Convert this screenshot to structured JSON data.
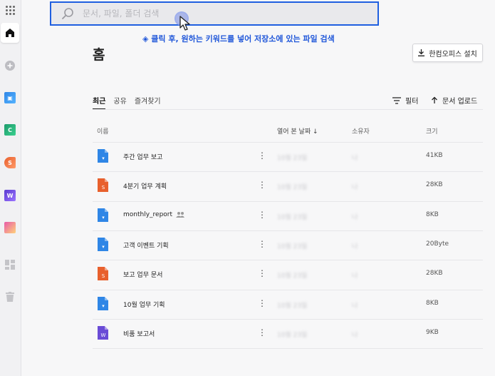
{
  "search": {
    "placeholder": "문서, 파일, 폴더 검색"
  },
  "hint": "◈ 클릭 후, 원하는 키워드를 넣어 저장소에 있는 파일 검색",
  "page_title": "홈",
  "install_button": "한컴오피스 설치",
  "tabs": [
    "최근",
    "공유",
    "즐겨찾기"
  ],
  "actions": {
    "filter": "필터",
    "upload": "문서 업로드"
  },
  "columns": {
    "name": "이름",
    "opened": "열어 본 날짜 ↓",
    "owner": "소유자",
    "size": "크기"
  },
  "rail_icons": [
    "apps-grid-icon",
    "home-icon",
    "add-icon",
    "docs-app-icon",
    "sheet-app-icon",
    "slide-app-icon",
    "word-app-icon",
    "note-app-icon",
    "template-icon",
    "trash-icon"
  ],
  "files": [
    {
      "name": "주간 업무 보고",
      "type": "docs",
      "opened": "10월 23일",
      "owner": "나",
      "size": "41KB",
      "shared": false
    },
    {
      "name": "4분기 업무 계획",
      "type": "slide",
      "opened": "10월 23일",
      "owner": "나",
      "size": "28KB",
      "shared": false
    },
    {
      "name": "monthly_report",
      "type": "docs",
      "opened": "10월 23일",
      "owner": "나",
      "size": "8KB",
      "shared": true
    },
    {
      "name": "고객 이벤트 기획",
      "type": "docs",
      "opened": "10월 23일",
      "owner": "나",
      "size": "20Byte",
      "shared": false
    },
    {
      "name": "보고 업무 문서",
      "type": "slide",
      "opened": "10월 23일",
      "owner": "나",
      "size": "28KB",
      "shared": false
    },
    {
      "name": "10월 업무 기획",
      "type": "docs",
      "opened": "10월 23일",
      "owner": "나",
      "size": "8KB",
      "shared": false
    },
    {
      "name": "비품 보고서",
      "type": "word",
      "opened": "10월 23일",
      "owner": "나",
      "size": "9KB",
      "shared": false
    }
  ],
  "colors": {
    "accent": "#1f5fe0",
    "docs": "#2f86e6",
    "slide": "#e8602d",
    "word": "#6a4bd6"
  }
}
